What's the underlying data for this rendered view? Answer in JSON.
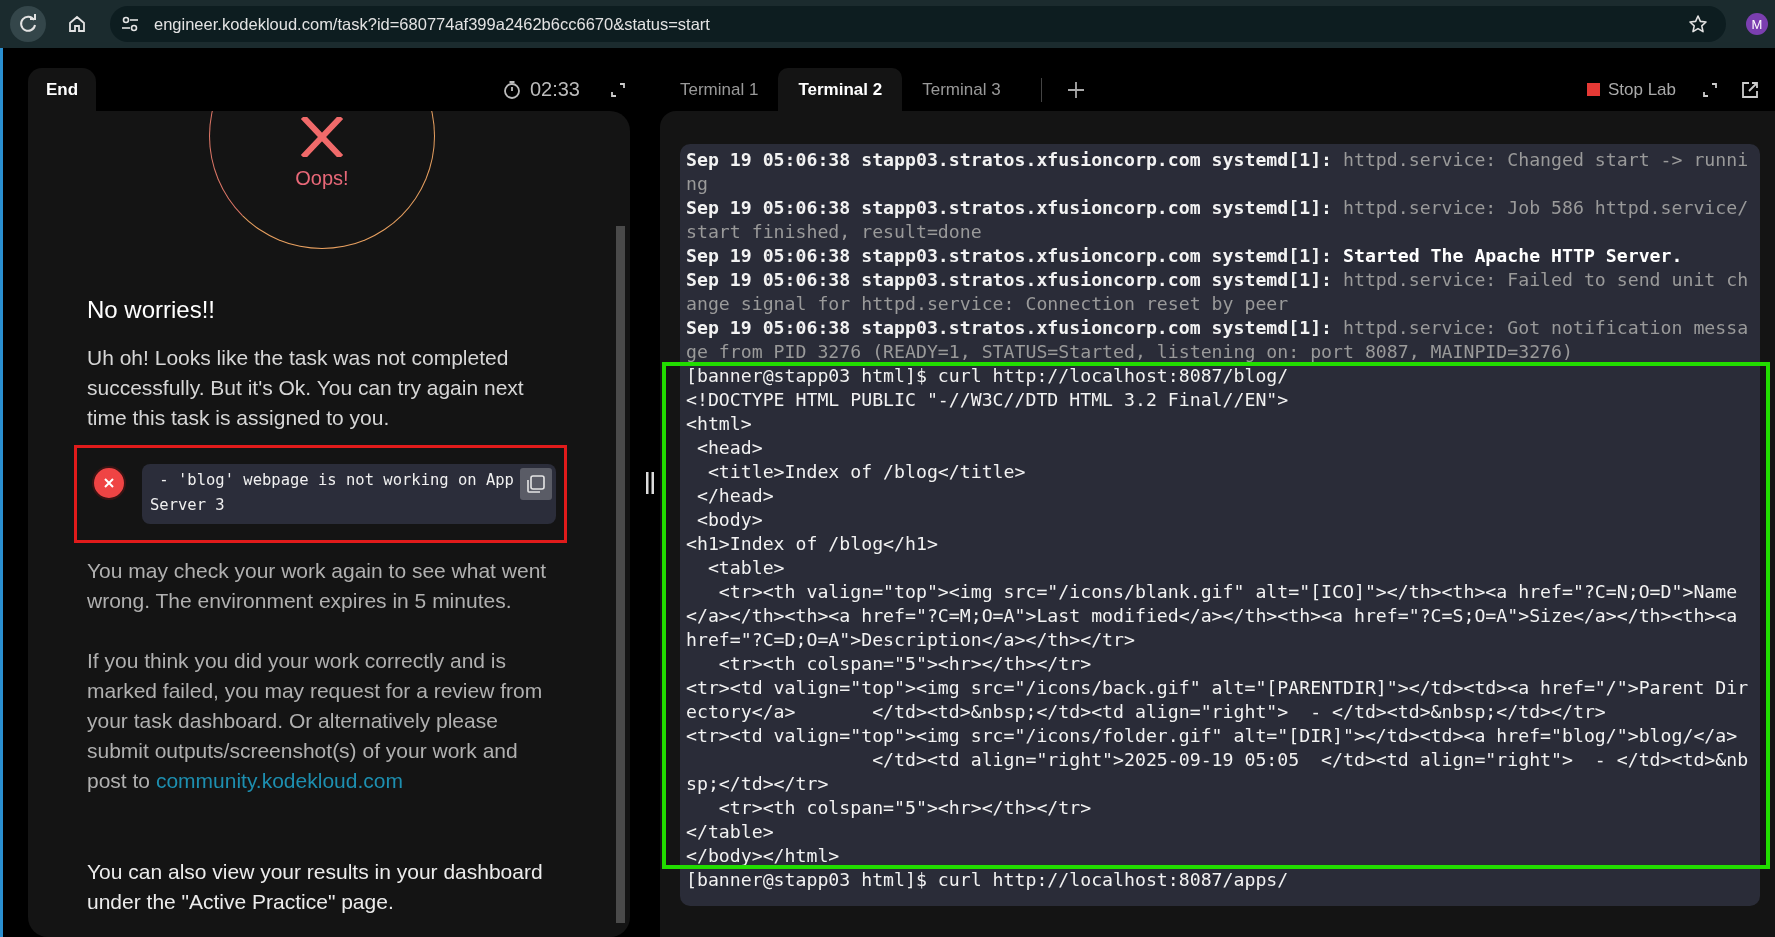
{
  "browser": {
    "url": "engineer.kodekloud.com/task?id=680774af399a2462b6cc6670&status=start",
    "avatar": "M"
  },
  "task_panel": {
    "tabs": [
      {
        "label": "End",
        "selected": true
      }
    ],
    "timer": "02:33",
    "result": {
      "label": "Oops!",
      "passed": false
    },
    "heading": "No worries!!",
    "message": "Uh oh! Looks like the task was not completed successfully. But it's Ok. You can try again next time this task is assigned to you.",
    "checks": [
      {
        "text": " - 'blog' webpage is not working on App Server 3",
        "passed": false,
        "highlighted": true
      }
    ],
    "info": "You may check your work again to see what went wrong. The environment expires in 5 minutes.",
    "review_note": "If you think you did your work correctly and is marked failed, you may request for a review from your task dashboard. Or alternatively please submit outputs/screenshot(s) of your work and post to",
    "link": "community.kodekloud.com",
    "footer": "You can also view your results in your dashboard under the \"Active Practice\" page."
  },
  "terminal": {
    "tabs": [
      {
        "label": "Terminal 1",
        "selected": false
      },
      {
        "label": "Terminal 2",
        "selected": true
      },
      {
        "label": "Terminal 3",
        "selected": false
      }
    ],
    "stop_button": "Stop Lab",
    "log_lines": [
      {
        "prefix": "Sep 19 05:06:38 stapp03.stratos.xfusioncorp.com systemd[1]:",
        "message": "httpd.service: Changed start -> running",
        "dim": true
      },
      {
        "prefix": "Sep 19 05:06:38 stapp03.stratos.xfusioncorp.com systemd[1]:",
        "message": "httpd.service: Job 586 httpd.service/start finished, result=done",
        "dim": true
      },
      {
        "prefix": "Sep 19 05:06:38 stapp03.stratos.xfusioncorp.com systemd[1]:",
        "message": "Started The Apache HTTP Server.",
        "dim": false
      },
      {
        "prefix": "Sep 19 05:06:38 stapp03.stratos.xfusioncorp.com systemd[1]:",
        "message": "httpd.service: Failed to send unit change signal for httpd.service: Connection reset by peer",
        "dim": true
      },
      {
        "prefix": "Sep 19 05:06:38 stapp03.stratos.xfusioncorp.com systemd[1]:",
        "message": "httpd.service: Got notification message from PID 3276 (READY=1, STATUS=Started, listening on: port 8087, MAINPID=3276)",
        "dim": true
      }
    ],
    "output_block": {
      "highlighted": true,
      "lines": [
        "[banner@stapp03 html]$ curl http://localhost:8087/blog/",
        "<!DOCTYPE HTML PUBLIC \"-//W3C//DTD HTML 3.2 Final//EN\">",
        "<html>",
        " <head>",
        "  <title>Index of /blog</title>",
        " </head>",
        " <body>",
        "<h1>Index of /blog</h1>",
        "  <table>",
        "   <tr><th valign=\"top\"><img src=\"/icons/blank.gif\" alt=\"[ICO]\"></th><th><a href=\"?C=N;O=D\">Name</a></th><th><a href=\"?C=M;O=A\">Last modified</a></th><th><a href=\"?C=S;O=A\">Size</a></th><th><a href=\"?C=D;O=A\">Description</a></th></tr>",
        "   <tr><th colspan=\"5\"><hr></th></tr>",
        "<tr><td valign=\"top\"><img src=\"/icons/back.gif\" alt=\"[PARENTDIR]\"></td><td><a href=\"/\">Parent Directory</a>       </td><td>&nbsp;</td><td align=\"right\">  - </td><td>&nbsp;</td></tr>",
        "<tr><td valign=\"top\"><img src=\"/icons/folder.gif\" alt=\"[DIR]\"></td><td><a href=\"blog/\">blog/</a>                  </td><td align=\"right\">2025-09-19 05:05  </td><td align=\"right\">  - </td><td>&nbsp;</td></tr>",
        "   <tr><th colspan=\"5\"><hr></th></tr>",
        "</table>",
        "</body></html>"
      ]
    },
    "prompt": "[banner@stapp03 html]$ curl http://localhost:8087/apps/"
  }
}
